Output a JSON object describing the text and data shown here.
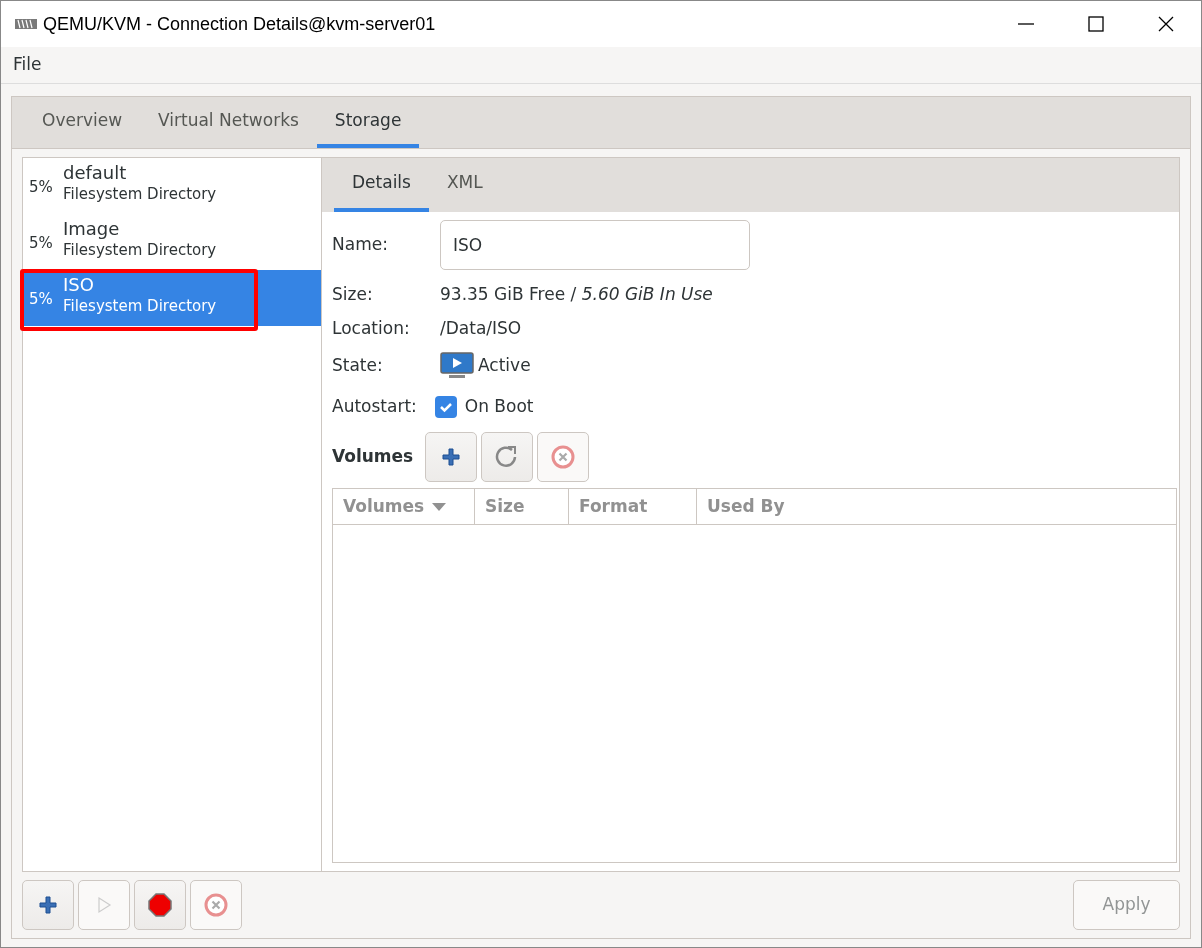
{
  "window": {
    "title": "QEMU/KVM - Connection Details@kvm-server01"
  },
  "menu": [
    "File"
  ],
  "tabs": [
    {
      "label": "Overview",
      "selected": false
    },
    {
      "label": "Virtual Networks",
      "selected": false
    },
    {
      "label": "Storage",
      "selected": true
    }
  ],
  "pools": [
    {
      "usage": "5%",
      "name": "default",
      "type": "Filesystem Directory",
      "selected": false,
      "highlighted": false
    },
    {
      "usage": "5%",
      "name": "Image",
      "type": "Filesystem Directory",
      "selected": false,
      "highlighted": false
    },
    {
      "usage": "5%",
      "name": "ISO",
      "type": "Filesystem Directory",
      "selected": true,
      "highlighted": true
    }
  ],
  "pool_buttons": [
    {
      "kind": "add",
      "disabled": false
    },
    {
      "kind": "start",
      "disabled": true
    },
    {
      "kind": "stop",
      "disabled": false
    },
    {
      "kind": "delete",
      "disabled": true
    }
  ],
  "detail_tabs": [
    {
      "label": "Details",
      "selected": true
    },
    {
      "label": "XML",
      "selected": false
    }
  ],
  "details": {
    "name_label": "Name:",
    "name_value": "ISO",
    "size_label": "Size:",
    "size_value": "93.35 GiB Free / *5.60 GiB In Use*",
    "location_label": "Location:",
    "location_value": "/Data/ISO",
    "state_label": "State:",
    "state_value": "Active",
    "autostart_label": "Autostart:",
    "autostart_value": "On Boot",
    "autostart_checked": true
  },
  "volumes": {
    "label": "Volumes",
    "buttons": [
      {
        "kind": "add",
        "disabled": false
      },
      {
        "kind": "refresh",
        "disabled": false
      },
      {
        "kind": "delete",
        "disabled": true
      }
    ],
    "columns": [
      {
        "label": "Volumes",
        "sorted": true
      },
      {
        "label": "Size",
        "sorted": false
      },
      {
        "label": "Format",
        "sorted": false
      },
      {
        "label": "Used By",
        "sorted": false
      }
    ]
  },
  "apply_button": {
    "label": "Apply",
    "disabled": true
  }
}
